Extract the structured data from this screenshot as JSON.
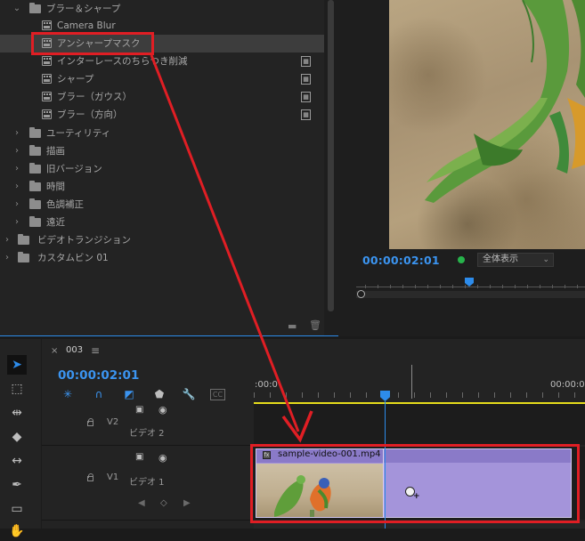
{
  "effects_panel": {
    "items": [
      {
        "label": "ブラー＆シャープ",
        "type": "folder",
        "expanded": true
      },
      {
        "label": "Camera Blur",
        "type": "effect"
      },
      {
        "label": "アンシャープマスク",
        "type": "effect",
        "selected": true
      },
      {
        "label": "インターレースのちらつき削減",
        "type": "effect",
        "accelerated": true
      },
      {
        "label": "シャープ",
        "type": "effect",
        "accelerated": true
      },
      {
        "label": "ブラー（ガウス）",
        "type": "effect",
        "accelerated": true
      },
      {
        "label": "ブラー（方向）",
        "type": "effect",
        "accelerated": true
      },
      {
        "label": "ユーティリティ",
        "type": "folder"
      },
      {
        "label": "描画",
        "type": "folder"
      },
      {
        "label": "旧バージョン",
        "type": "folder"
      },
      {
        "label": "時間",
        "type": "folder"
      },
      {
        "label": "色調補正",
        "type": "folder"
      },
      {
        "label": "遠近",
        "type": "folder"
      },
      {
        "label": "ビデオトランジション",
        "type": "folder"
      },
      {
        "label": "カスタムビン 01",
        "type": "folder"
      }
    ]
  },
  "program_monitor": {
    "timecode": "00:00:02:01",
    "zoom": "全体表示"
  },
  "timeline": {
    "sequence_name": "003",
    "close_label": "×",
    "menu_label": "≡",
    "timecode": "00:00:02:01",
    "ruler_start": ":00:0",
    "ruler_end": "00:00:0",
    "tracks": [
      {
        "id": "V2",
        "name": "ビデオ 2"
      },
      {
        "id": "V1",
        "name": "ビデオ 1"
      }
    ],
    "clip": {
      "name": "sample-video-001.mp4",
      "fx_badge": "fx"
    },
    "cc_label": "CC"
  },
  "colors": {
    "accent": "#2d8ceb",
    "clip": "#a494da",
    "annotation": "#e01e24",
    "work_area": "#e5dc1b"
  }
}
